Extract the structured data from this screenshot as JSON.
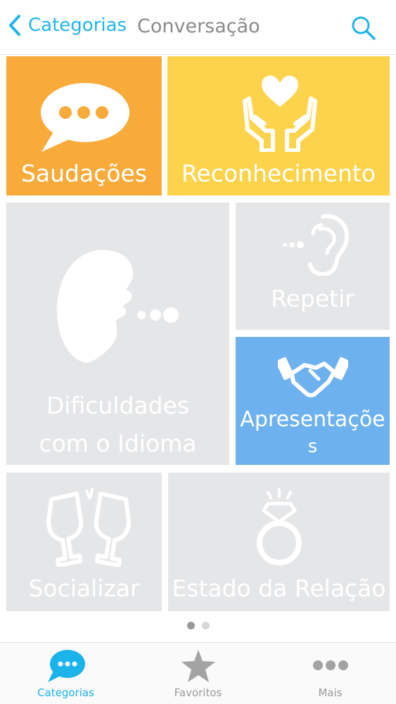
{
  "nav": {
    "back_label": "Categorias",
    "title": "Conversação"
  },
  "tiles": [
    {
      "label": "Saudações",
      "icon": "speech-bubble-icon",
      "color": "#f8ab3a"
    },
    {
      "label": "Reconhecimento",
      "icon": "heart-hands-icon",
      "color": "#fdd34b"
    },
    {
      "label_line1": "Dificuldades",
      "label_line2": "com o Idioma",
      "icon": "speaking-face-icon",
      "color": "#e5e6e8"
    },
    {
      "label": "Repetir",
      "icon": "ear-icon",
      "color": "#e5e6e8"
    },
    {
      "label_line1": "Apresentaçõe",
      "label_line2": "s",
      "icon": "handshake-icon",
      "color": "#6db1ef"
    },
    {
      "label": "Socializar",
      "icon": "toast-glasses-icon",
      "color": "#e5e6e8"
    },
    {
      "label": "Estado da Relação",
      "icon": "diamond-ring-icon",
      "color": "#e5e6e8"
    }
  ],
  "pager": {
    "pages": 2,
    "current": 1
  },
  "tabbar": {
    "items": [
      {
        "label": "Categorias",
        "icon": "chat-bubble-icon",
        "active": true
      },
      {
        "label": "Favoritos",
        "icon": "star-icon",
        "active": false
      },
      {
        "label": "Mais",
        "icon": "more-dots-icon",
        "active": false
      }
    ]
  },
  "colors": {
    "accent": "#1ab3ea",
    "orange": "#f8ab3a",
    "yellow": "#fdd34b",
    "gray": "#e5e6e8",
    "blue": "#6db1ef"
  }
}
